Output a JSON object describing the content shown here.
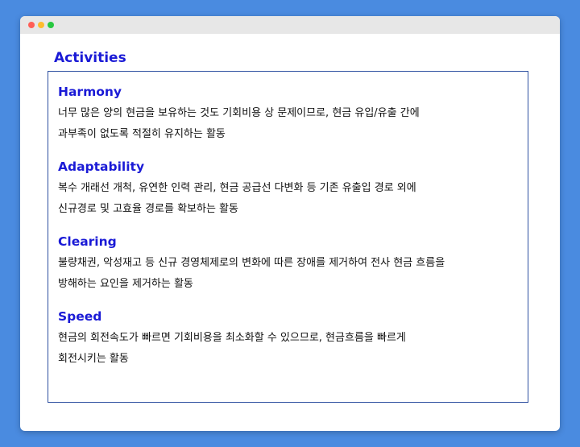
{
  "page": {
    "title": "Activities"
  },
  "sections": [
    {
      "title": "Harmony",
      "lines": [
        "너무 많은 양의 현금을 보유하는 것도 기회비용 상 문제이므로, 현금 유입/유출 간에",
        "과부족이 없도록 적절히 유지하는 활동"
      ]
    },
    {
      "title": "Adaptability",
      "lines": [
        "복수 개래선 개척, 유연한 인력 관리, 현금 공급선 다변화 등 기존 유출입 경로 외에",
        "신규경로 및 고효율 경로를 확보하는 활동"
      ]
    },
    {
      "title": "Clearing",
      "lines": [
        "불량채권, 악성재고 등 신규 경영체제로의 변화에 따른 장애를 제거하여 전사 현금 흐름을",
        "방해하는 요인을 제거하는 활동"
      ]
    },
    {
      "title": "Speed",
      "lines": [
        "현금의 회전속도가 빠르면 기회비용을 최소화할 수 있으므로, 현금흐름을 빠르게",
        "회전시키는 활동"
      ]
    }
  ],
  "colors": {
    "background": "#4a8be0",
    "heading": "#1a1ad6",
    "box_border": "#2d4fa0",
    "text": "#111111"
  }
}
